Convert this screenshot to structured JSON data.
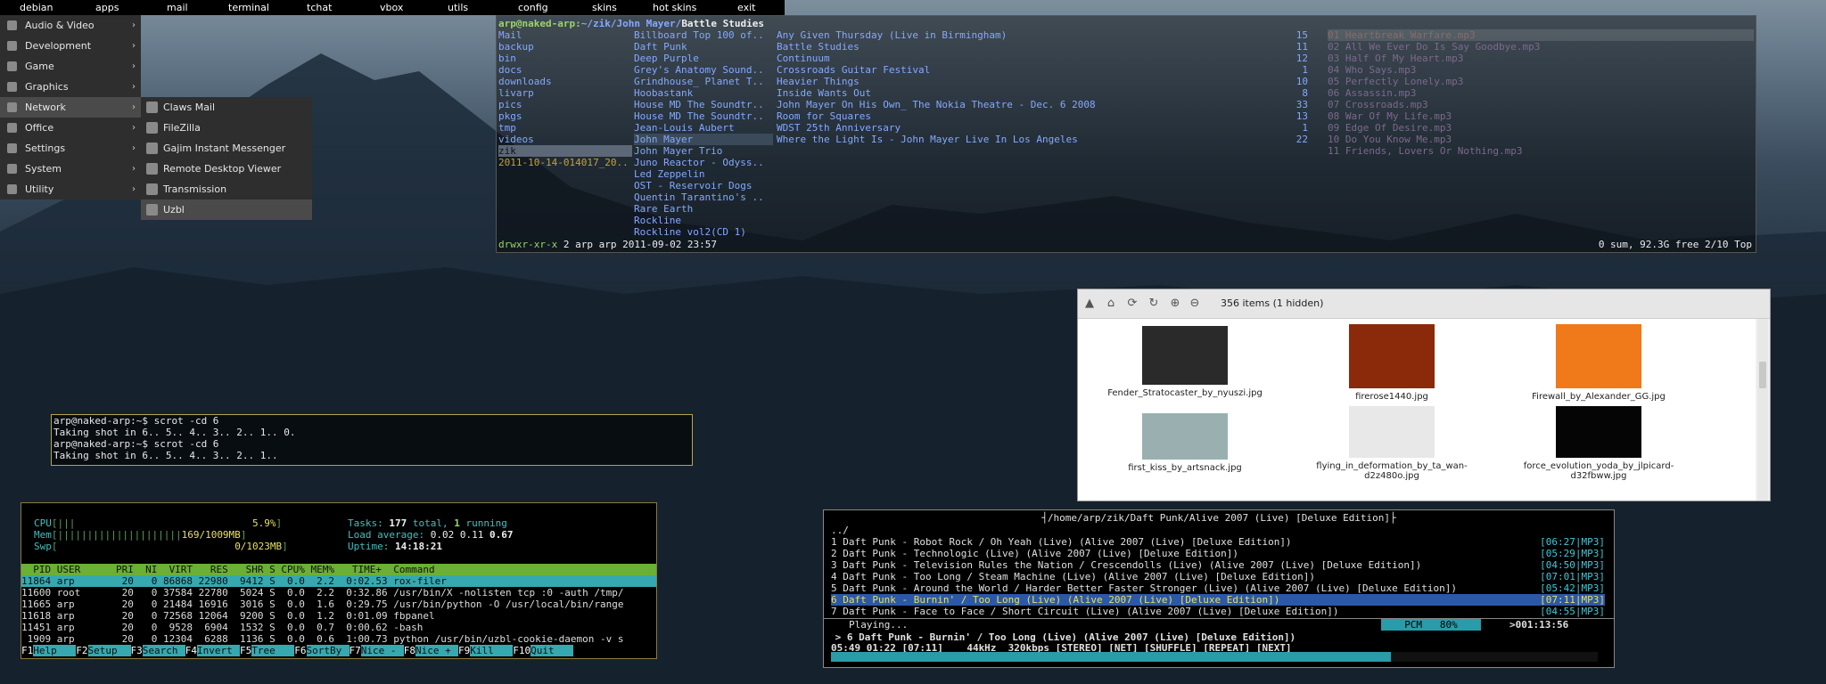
{
  "topbar": [
    "debian",
    "apps",
    "mail",
    "terminal",
    "tchat",
    "vbox",
    "utils",
    "config",
    "skins",
    "hot skins",
    "exit"
  ],
  "menu_main": [
    {
      "label": "Audio & Video",
      "arrow": "›"
    },
    {
      "label": "Development",
      "arrow": "›"
    },
    {
      "label": "Game",
      "arrow": "›"
    },
    {
      "label": "Graphics",
      "arrow": "›"
    },
    {
      "label": "Network",
      "arrow": "›"
    },
    {
      "label": "Office",
      "arrow": "›"
    },
    {
      "label": "Settings",
      "arrow": "›"
    },
    {
      "label": "System",
      "arrow": "›"
    },
    {
      "label": "Utility",
      "arrow": "›"
    }
  ],
  "menu_network": [
    "Claws Mail",
    "FileZilla",
    "Gajim Instant Messenger",
    "Remote Desktop Viewer",
    "Transmission",
    "Uzbl"
  ],
  "ranger": {
    "path_user": "arp@naked-arp:",
    "path_dir": "~/zik/John Mayer/",
    "path_cur": "Battle Studies",
    "col1": [
      "Mail",
      "backup",
      "bin",
      "docs",
      "downloads",
      "livarp",
      "pics",
      "pkgs",
      "tmp",
      "videos",
      "zik",
      "2011-10-14-014017_20.."
    ],
    "col2": [
      "Billboard Top 100 of..",
      "Daft Punk",
      "Deep Purple",
      "Grey's Anatomy Sound..",
      "Grindhouse_ Planet T..",
      "Hoobastank",
      "House MD The Soundtr..",
      "House MD The Soundtr..",
      "Jean-Louis Aubert",
      "John Mayer",
      "John Mayer Trio",
      "Juno Reactor - Odyss..",
      "Led Zeppelin",
      "OST - Reservoir Dogs",
      "Quentin Tarantino's ..",
      "Rare Earth",
      "Rockline",
      "Rockline vol2(CD 1)"
    ],
    "col3": [
      {
        "name": "Any Given Thursday (Live in Birmingham)",
        "n": "15"
      },
      {
        "name": "Battle Studies",
        "n": "11"
      },
      {
        "name": "Continuum",
        "n": "12"
      },
      {
        "name": "Crossroads Guitar Festival",
        "n": "1"
      },
      {
        "name": "Heavier Things",
        "n": "10"
      },
      {
        "name": "Inside Wants Out",
        "n": "8"
      },
      {
        "name": "John Mayer On His Own_ The Nokia Theatre - Dec. 6 2008",
        "n": "33"
      },
      {
        "name": "Room for Squares",
        "n": "13"
      },
      {
        "name": "WDST 25th Anniversary",
        "n": "1"
      },
      {
        "name": "Where the Light Is - John Mayer Live In Los Angeles",
        "n": "22"
      }
    ],
    "col4": [
      "01 Heartbreak Warfare.mp3",
      "02 All We Ever Do Is Say Goodbye.mp3",
      "03 Half Of My Heart.mp3",
      "04 Who Says.mp3",
      "05 Perfectly Lonely.mp3",
      "06 Assassin.mp3",
      "07 Crossroads.mp3",
      "08 War Of My Life.mp3",
      "09 Edge Of Desire.mp3",
      "10 Do You Know Me.mp3",
      "11 Friends, Lovers Or Nothing.mp3"
    ],
    "status_perm": "drwxr-xr-x",
    "status_info": "2 arp arp 2011-09-02 23:57",
    "status_right": "0 sum, 92.3G free  2/10  Top"
  },
  "term": [
    "arp@naked-arp:~$ scrot -cd 6",
    "Taking shot in 6.. 5.. 4.. 3.. 2.. 1.. 0.",
    "arp@naked-arp:~$ scrot -cd 6",
    "Taking shot in 6.. 5.. 4.. 3.. 2.. 1.."
  ],
  "htop": {
    "cpu_label": "CPU",
    "cpu_val": "5.9%",
    "mem_label": "Mem",
    "mem_val": "169/1009MB",
    "swp_label": "Swp",
    "swp_val": "0/1023MB",
    "tasks_label": "Tasks: ",
    "tasks_total": "177",
    "tasks_mid": " total, ",
    "tasks_running": "1",
    "tasks_end": " running",
    "load_label": "Load average: ",
    "load_vals": "0.02 0.11 ",
    "load_last": "0.67",
    "uptime_label": "Uptime: ",
    "uptime_val": "14:18:21",
    "header": "  PID USER      PRI  NI  VIRT   RES   SHR S CPU% MEM%   TIME+  Command",
    "rows": [
      "11864 arp        20   0 86868 22980  9412 S  0.0  2.2  0:02.53 rox-filer",
      "11600 root       20   0 37584 22780  5024 S  0.0  2.2  0:32.86 /usr/bin/X -nolisten tcp :0 -auth /tmp/",
      "11665 arp        20   0 21484 16916  3016 S  0.0  1.6  0:29.75 /usr/bin/python -O /usr/local/bin/range",
      "11618 arp        20   0 72568 12064  9200 S  0.0  1.2  0:01.09 fbpanel",
      "11451 arp        20   0  9528  6904  1532 S  0.0  0.7  0:00.62 -bash",
      " 1909 arp        20   0 12304  6288  1136 S  0.0  0.6  1:00.73 python /usr/bin/uzbl-cookie-daemon -v s"
    ],
    "fkeys": [
      [
        "F1",
        "Help"
      ],
      [
        "F2",
        "Setup"
      ],
      [
        "F3",
        "Search"
      ],
      [
        "F4",
        "Invert"
      ],
      [
        "F5",
        "Tree"
      ],
      [
        "F6",
        "SortBy"
      ],
      [
        "F7",
        "Nice -"
      ],
      [
        "F8",
        "Nice +"
      ],
      [
        "F9",
        "Kill"
      ],
      [
        "F10",
        "Quit"
      ]
    ]
  },
  "fm": {
    "count": "356 items (1 hidden)",
    "items": [
      {
        "name": "Fender_Stratocaster_by_nyuszi.jpg",
        "color": "#2a2a2a"
      },
      {
        "name": "firerose1440.jpg",
        "color": "#8a2a0a"
      },
      {
        "name": "Firewall_by_Alexander_GG.jpg",
        "color": "#f07a1a"
      },
      {
        "name": "first_kiss_by_artsnack.jpg",
        "color": "#9ab0b0"
      },
      {
        "name": "flying_in_deformation_by_ta_wan-d2z480o.jpg",
        "color": "#e8e8e8"
      },
      {
        "name": "force_evolution_yoda_by_jlpicard-d32fbww.jpg",
        "color": "#050505"
      }
    ]
  },
  "cmus": {
    "title": "/home/arp/zik/Daft Punk/Alive 2007 (Live) [Deluxe Edition]",
    "updir": "../",
    "tracks": [
      {
        "t": "1 Daft Punk - Robot Rock / Oh Yeah (Live) (Alive 2007 (Live) [Deluxe Edition])",
        "d": "[06:27|MP3]"
      },
      {
        "t": "2 Daft Punk - Technologic (Live) (Alive 2007 (Live) [Deluxe Edition])",
        "d": "[05:29|MP3]"
      },
      {
        "t": "3 Daft Punk - Television Rules the Nation / Crescendolls (Live) (Alive 2007 (Live) [Deluxe Edition])",
        "d": "[04:50|MP3]"
      },
      {
        "t": "4 Daft Punk - Too Long / Steam Machine (Live) (Alive 2007 (Live) [Deluxe Edition])",
        "d": "[07:01|MP3]"
      },
      {
        "t": "5 Daft Punk - Around the World / Harder Better Faster Stronger (Live) (Alive 2007 (Live) [Deluxe Edition])",
        "d": "[05:42|MP3]"
      },
      {
        "t": "6 Daft Punk - Burnin' / Too Long (Live) (Alive 2007 (Live) [Deluxe Edition])",
        "d": "[07:11|MP3]"
      },
      {
        "t": "7 Daft Punk - Face to Face / Short Circuit (Live) (Alive 2007 (Live) [Deluxe Edition])",
        "d": "[04:55|MP3]"
      }
    ],
    "playing": "Playing...",
    "pcm": "PCM   80%",
    "total": ">001:13:56",
    "now": " > 6 Daft Punk - Burnin' / Too Long (Live) (Alive 2007 (Live) [Deluxe Edition])",
    "status": "05:49 01:22 [07:11]    44kHz  320kbps [STEREO] [NET] [SHUFFLE] [REPEAT] [NEXT]",
    "progress": 0.73
  }
}
